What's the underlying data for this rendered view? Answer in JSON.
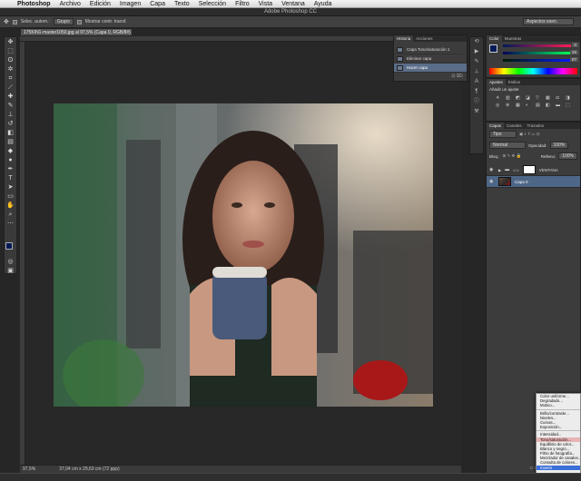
{
  "menubar": {
    "app": "Photoshop",
    "items": [
      "Archivo",
      "Edición",
      "Imagen",
      "Capa",
      "Texto",
      "Selección",
      "Filtro",
      "Vista",
      "Ventana",
      "Ayuda"
    ]
  },
  "window": {
    "title": "Adobe Photoshop CC"
  },
  "options": {
    "autoselect": "Selec. autom.:",
    "group": "Grupo",
    "transform": "Mostrar contr. transf.",
    "workspace": "Aspectos esen."
  },
  "document": {
    "tab": "175KIN1-master1050.jpg al 97,5% (Capa 0, RGB/8#) *",
    "zoom": "97,5%",
    "size": "37,04 cm x 29,63 cm (72 ppp)"
  },
  "history": {
    "tabs": [
      "Historia",
      "Acciones"
    ],
    "items": [
      {
        "label": "Capa Tono/saturación 1",
        "selected": false
      },
      {
        "label": "Eliminar capa",
        "selected": false
      },
      {
        "label": "Hacer capa",
        "selected": true
      }
    ]
  },
  "color": {
    "tabs": [
      "Color",
      "Muestras"
    ],
    "r": "0",
    "g": "26",
    "b": "87"
  },
  "adjustments": {
    "tabs": [
      "Ajustes",
      "Estilos"
    ],
    "add_label": "Añadir un ajuste"
  },
  "layers": {
    "tabs": [
      "Capas",
      "Canales",
      "Trazados"
    ],
    "kind": "Tipo",
    "blend": "Normal",
    "opacity_label": "Opacidad:",
    "opacity": "100%",
    "lock_label": "Bloq.:",
    "fill_label": "Relleno:",
    "fill": "100%",
    "items": [
      {
        "name": "VENTANA",
        "selected": false
      },
      {
        "name": "Capa 0",
        "selected": true
      }
    ]
  },
  "context_menu": {
    "items": [
      "Color uniforme...",
      "Degradado...",
      "Motivo...",
      "---",
      "Brillo/contraste...",
      "Niveles...",
      "Curvas...",
      "Exposición...",
      "---",
      "Intensidad...",
      "Tono/saturación...",
      "Equilibrio de color...",
      "Blanco y negro...",
      "Filtro de fotografía...",
      "Mezclador de canales...",
      "Consulta de colores...",
      "Invertir"
    ],
    "highlighted": "Tono/saturación...",
    "active": "Invertir"
  },
  "colors": {
    "accent": "#4e6687",
    "menu_highlight": "#3b6fd9"
  }
}
